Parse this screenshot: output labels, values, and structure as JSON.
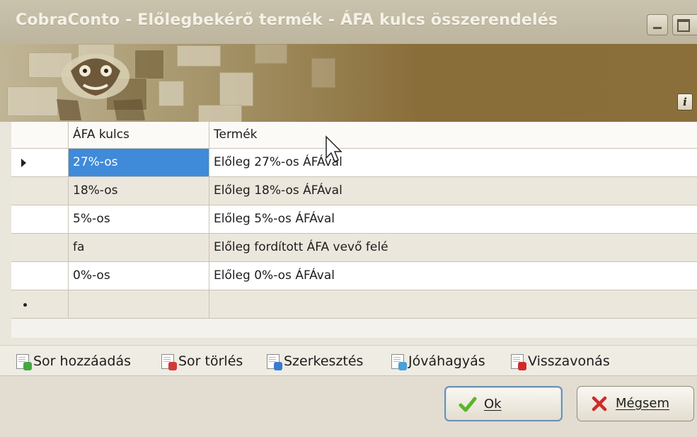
{
  "window": {
    "title": "CobraConto - Előlegbekérő termék - ÁFA kulcs összerendelés"
  },
  "banner": {
    "info_label": "i"
  },
  "grid": {
    "columns": [
      "ÁFA kulcs",
      "Termék"
    ],
    "rows": [
      {
        "afa_kulcs": "27%-os",
        "termek": "Előleg 27%-os ÁFÁval",
        "selected": true
      },
      {
        "afa_kulcs": "18%-os",
        "termek": "Előleg 18%-os ÁFÁval"
      },
      {
        "afa_kulcs": "5%-os",
        "termek": "Előleg 5%-os ÁFÁval"
      },
      {
        "afa_kulcs": "fa",
        "termek": "Előleg fordított ÁFA vevő felé"
      },
      {
        "afa_kulcs": "0%-os",
        "termek": "Előleg 0%-os ÁFÁval"
      }
    ]
  },
  "toolbar": {
    "add_row": "Sor hozzáadás",
    "delete_row": "Sor törlés",
    "edit": "Szerkesztés",
    "approve": "Jóváhagyás",
    "revert": "Visszavonás"
  },
  "buttons": {
    "ok": "Ok",
    "cancel": "Mégsem"
  },
  "colors": {
    "selection": "#3f8ad9",
    "ok_check": "#5bb52a",
    "cancel_x": "#d02a2a"
  }
}
